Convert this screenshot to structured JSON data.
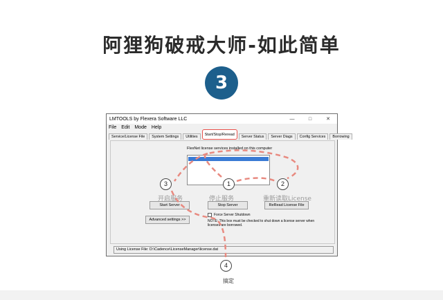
{
  "headline": "阿狸狗破戒大师-如此简单",
  "step_badge": "3",
  "window": {
    "title": "LMTOOLS by Flexera Software LLC",
    "controls": [
      "—",
      "□",
      "✕"
    ],
    "menu": [
      "File",
      "Edit",
      "Mode",
      "Help"
    ],
    "tabs": [
      "Service/License File",
      "System Settings",
      "Utilities",
      "Start/Stop/Reread",
      "Server Status",
      "Server Diags",
      "Config Services",
      "Borrowing"
    ],
    "active_tab_index": 3,
    "flexnet_label": "FlexNet license services installed on this computer",
    "start_server_label": "Start Server",
    "stop_server_label": "Stop Server",
    "reread_label": "ReRead License File",
    "advanced_label": "Advanced settings >>",
    "force_shutdown_label": "Force Server Shutdown",
    "note_text": "NOTE:  This box must be checked to shut down a license server when licenses are borrowed.",
    "status_text": "Using License File:  D:\\Cadence\\LicenseManager\\license.dat"
  },
  "annotations": {
    "start_cn": "开启服务",
    "stop_cn": "停止服务",
    "reread_cn": "重新读取License",
    "steps": [
      "1",
      "2",
      "3",
      "4"
    ],
    "done": "搞定"
  },
  "colors": {
    "badge": "#1d5f8c",
    "arrow": "#e88a80",
    "highlight": "#e8504a"
  }
}
